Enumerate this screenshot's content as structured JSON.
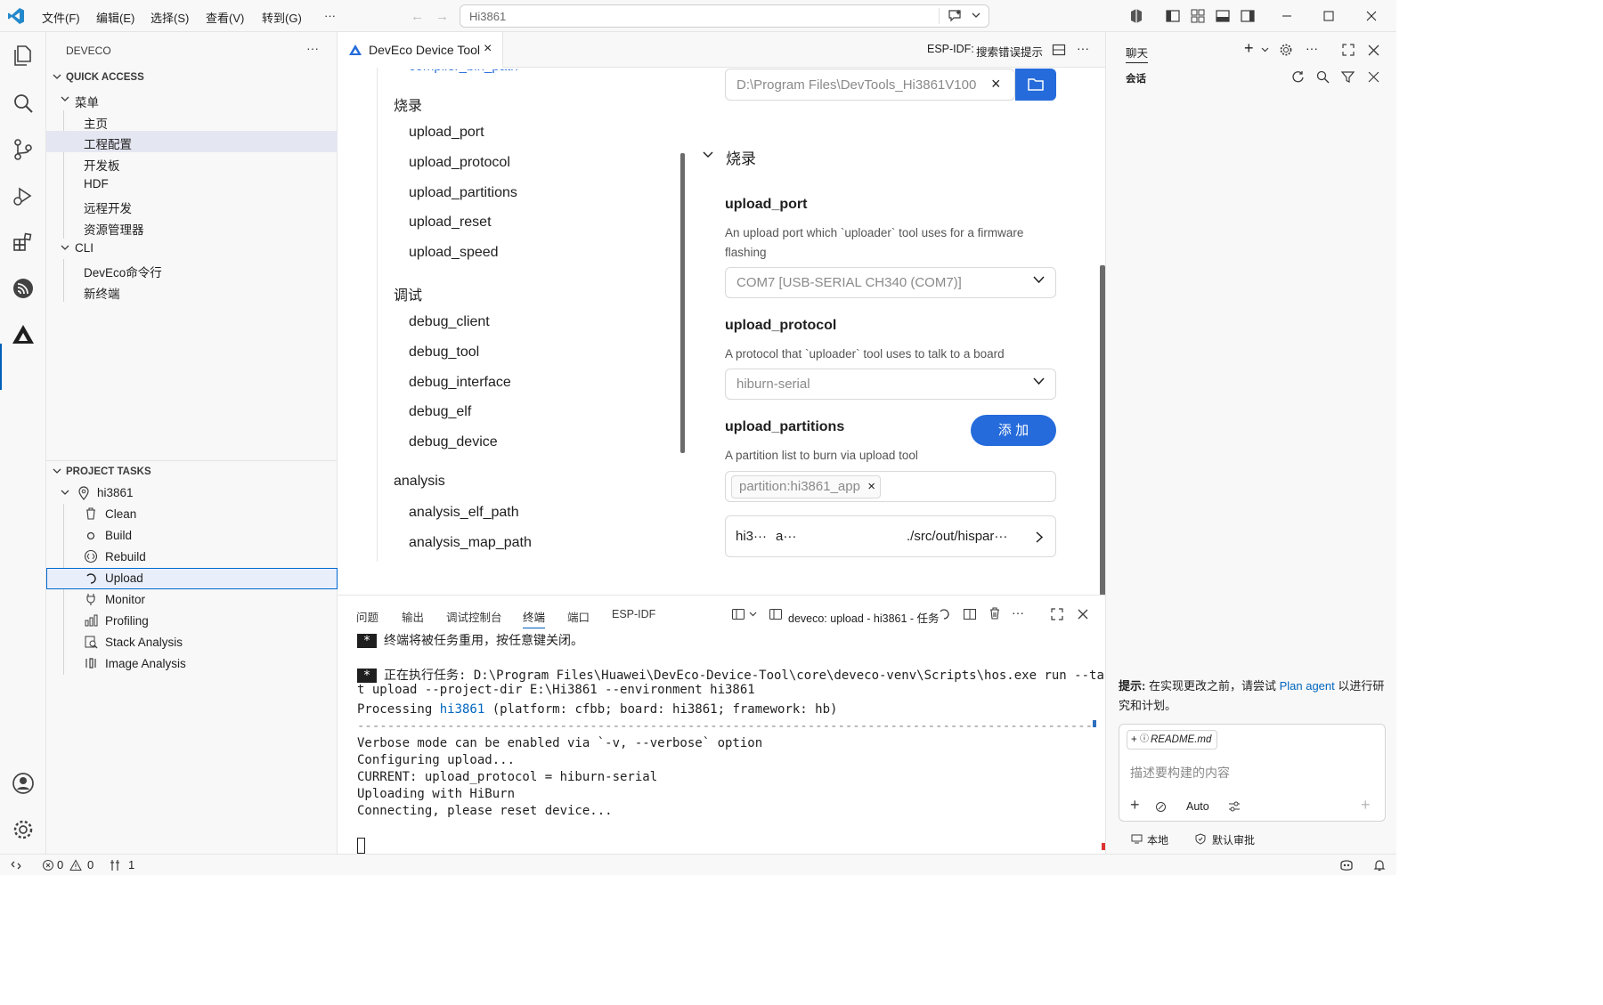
{
  "titlebar": {
    "menus": [
      "文件(F)",
      "编辑(E)",
      "选择(S)",
      "查看(V)",
      "转到(G)",
      "···"
    ],
    "search_text": "Hi3861"
  },
  "sidebar": {
    "title": "DEVECO",
    "more": "···",
    "quick_access": {
      "header": "QUICK ACCESS",
      "menu_group": "菜单",
      "menu_items": [
        "主页",
        "工程配置",
        "开发板",
        "HDF",
        "远程开发",
        "资源管理器"
      ],
      "cli_group": "CLI",
      "cli_items": [
        "DevEco命令行",
        "新终端"
      ]
    },
    "project_tasks": {
      "header": "PROJECT TASKS",
      "project": "hi3861",
      "tasks": [
        "Clean",
        "Build",
        "Rebuild",
        "Upload",
        "Monitor",
        "Profiling",
        "Stack Analysis",
        "Image Analysis"
      ]
    }
  },
  "editor": {
    "tab_label": "DevEco Device Tool",
    "tab_close": "×",
    "esp_label": "ESP-IDF:",
    "esp_link": "搜索错误提示",
    "more": "···",
    "toc": {
      "cut_item": "compiler_bin_path",
      "section1": "烧录",
      "items1": [
        "upload_port",
        "upload_protocol",
        "upload_partitions",
        "upload_reset",
        "upload_speed"
      ],
      "section2": "调试",
      "items2": [
        "debug_client",
        "debug_tool",
        "debug_interface",
        "debug_elf",
        "debug_device"
      ],
      "section3": "analysis",
      "items3": [
        "analysis_elf_path",
        "analysis_map_path"
      ]
    },
    "form": {
      "path_value": "D:\\Program Files\\DevTools_Hi3861V100",
      "path_clear": "×",
      "section_title": "烧录",
      "upload_port": {
        "title": "upload_port",
        "desc": "An upload port which `uploader` tool uses for a firmware flashing",
        "value": "COM7 [USB-SERIAL CH340 (COM7)]"
      },
      "upload_protocol": {
        "title": "upload_protocol",
        "desc": "A protocol that `uploader` tool uses to talk to a board",
        "value": "hiburn-serial"
      },
      "upload_partitions": {
        "title": "upload_partitions",
        "add_button": "添 加",
        "desc": "A partition list to burn via upload tool",
        "tag": "partition:hi3861_app",
        "tag_remove": "×",
        "row_name": "hi3···",
        "row_a": "a···",
        "row_path": "./src/out/hispar···",
        "row_arrow": ">"
      }
    }
  },
  "panel": {
    "tabs": [
      "问题",
      "输出",
      "调试控制台",
      "终端",
      "端口",
      "ESP-IDF"
    ],
    "active_tab": "终端",
    "task_label": "deveco: upload - hi3861 - 任务",
    "more": "···",
    "terminal": {
      "badge": "*",
      "line1": "终端将被任务重用，按任意键关闭。",
      "line2": "正在执行任务: D:\\Program Files\\Huawei\\DevEco-Device-Tool\\core\\deveco-venv\\Scripts\\hos.exe run --targe",
      "line3": "t upload --project-dir E:\\Hi3861 --environment hi3861",
      "line4_pre": "Processing ",
      "line4_link": "hi3861",
      "line4_post": " (platform: cfbb; board: hi3861; framework: hb)",
      "separator": "------------------------------------------------------------------------------------------------------------",
      "line5": "Verbose mode can be enabled via `-v, --verbose` option",
      "line6": "Configuring upload...",
      "line7": "CURRENT: upload_protocol = hiburn-serial",
      "line8": "Uploading with HiBurn",
      "line9": "Connecting, please reset device..."
    }
  },
  "chat": {
    "title": "聊天",
    "subtitle": "会话",
    "more": "···",
    "tip_bold": "提示:",
    "tip_text": " 在实现更改之前，请尝试 ",
    "tip_link": "Plan agent",
    "tip_tail": " 以进行研究和计划。",
    "context_file": "README.md",
    "input_placeholder": "描述要构建的内容",
    "mode": "Auto",
    "footer_left": "本地",
    "footer_right": "默认审批"
  },
  "statusbar": {
    "errors": "0",
    "warnings": "0",
    "ports": "1"
  },
  "colors": {
    "accent": "#005fb8",
    "button_blue": "#256bdb",
    "link": "#0066bf"
  }
}
